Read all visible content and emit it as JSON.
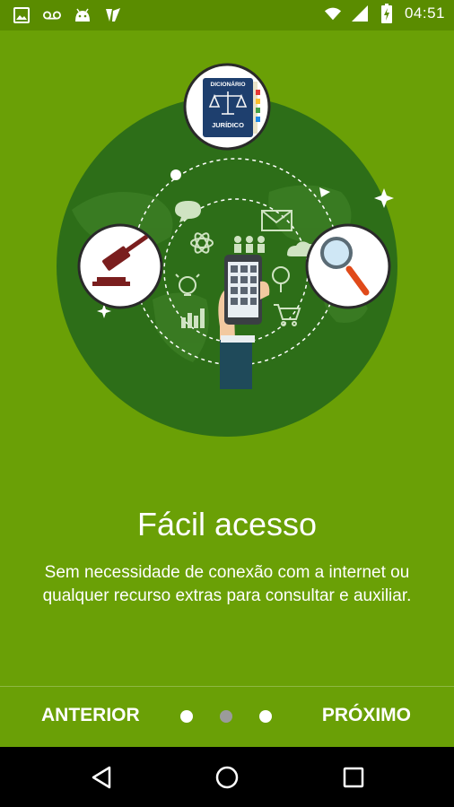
{
  "status_bar": {
    "icons_left": [
      "image-icon",
      "voicemail-icon",
      "android-icon",
      "app-logo-icon"
    ],
    "icons_right": [
      "wifi-icon",
      "signal-icon",
      "battery-charging-icon"
    ],
    "time": "04:51"
  },
  "slide": {
    "illustration": {
      "book_label_line1": "DICIONÁRIO",
      "book_label_line2": "JURÍDICO",
      "icons": [
        "book-icon",
        "gavel-icon",
        "magnifier-icon",
        "phone-in-hand-icon",
        "chat-icon",
        "mail-icon",
        "atom-icon",
        "people-icon",
        "cloud-icon",
        "lightbulb-icon",
        "bar-chart-icon",
        "cart-icon",
        "location-icon",
        "send-icon",
        "sparkle-icon"
      ]
    },
    "title": "Fácil acesso",
    "description": "Sem necessidade de conexão com a internet ou qualquer recurso extras para consultar e auxiliar."
  },
  "pager": {
    "prev_label": "ANTERIOR",
    "next_label": "PRÓXIMO",
    "total_pages": 3,
    "current_page": 2
  },
  "nav_bar": {
    "buttons": [
      "back-icon",
      "home-icon",
      "recents-icon"
    ]
  },
  "colors": {
    "status_bar_bg": "#5a8c00",
    "background": "#6aa006",
    "circle": "#2d6e18",
    "gavel": "#7a1e1e",
    "magnifier_handle": "#e04a1a"
  }
}
